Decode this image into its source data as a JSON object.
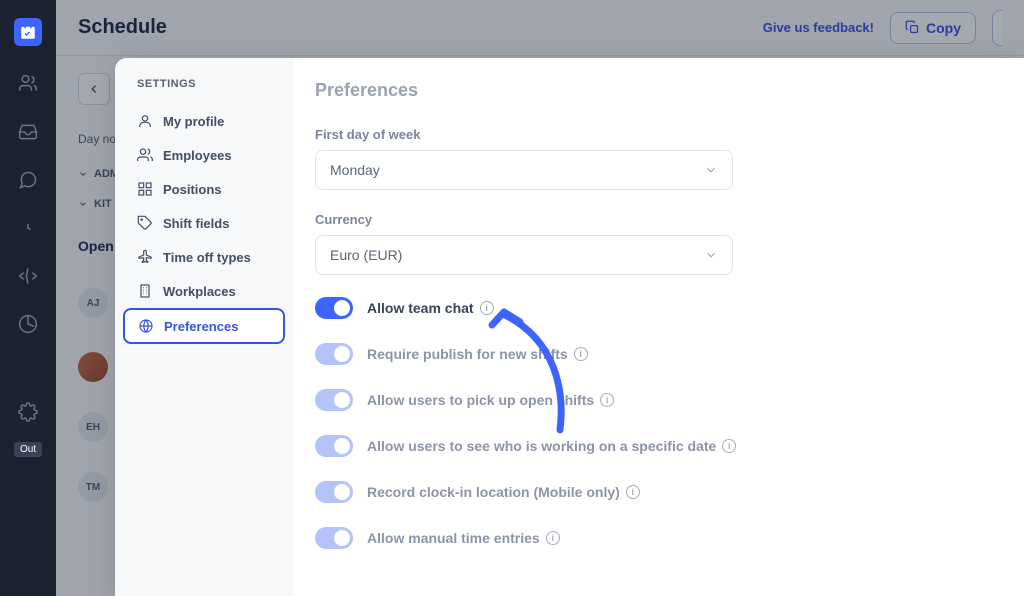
{
  "appSidebar": {
    "outBadge": "Out"
  },
  "header": {
    "title": "Schedule",
    "feedbackLabel": "Give us feedback!",
    "copyLabel": "Copy"
  },
  "background": {
    "dayNotesLabel": "Day not",
    "groups": [
      "ADM",
      "KIT"
    ],
    "openLabel": "Open",
    "avatars": [
      "AJ",
      "",
      "EH",
      "TM"
    ]
  },
  "settings": {
    "title": "SETTINGS",
    "items": [
      {
        "label": "My profile",
        "icon": "user"
      },
      {
        "label": "Employees",
        "icon": "users"
      },
      {
        "label": "Positions",
        "icon": "grid"
      },
      {
        "label": "Shift fields",
        "icon": "tag"
      },
      {
        "label": "Time off types",
        "icon": "plane"
      },
      {
        "label": "Workplaces",
        "icon": "building"
      },
      {
        "label": "Preferences",
        "icon": "globe",
        "active": true
      }
    ]
  },
  "preferences": {
    "title": "Preferences",
    "firstDayLabel": "First day of week",
    "firstDayValue": "Monday",
    "currencyLabel": "Currency",
    "currencyValue": "Euro (EUR)",
    "toggles": [
      {
        "label": "Allow team chat",
        "bright": true
      },
      {
        "label": "Require publish for new shifts",
        "bright": false
      },
      {
        "label": "Allow users to pick up open shifts",
        "bright": false
      },
      {
        "label": "Allow users to see who is working on a specific date",
        "bright": false
      },
      {
        "label": "Record clock-in location (Mobile only)",
        "bright": false
      },
      {
        "label": "Allow manual time entries",
        "bright": false
      }
    ]
  }
}
